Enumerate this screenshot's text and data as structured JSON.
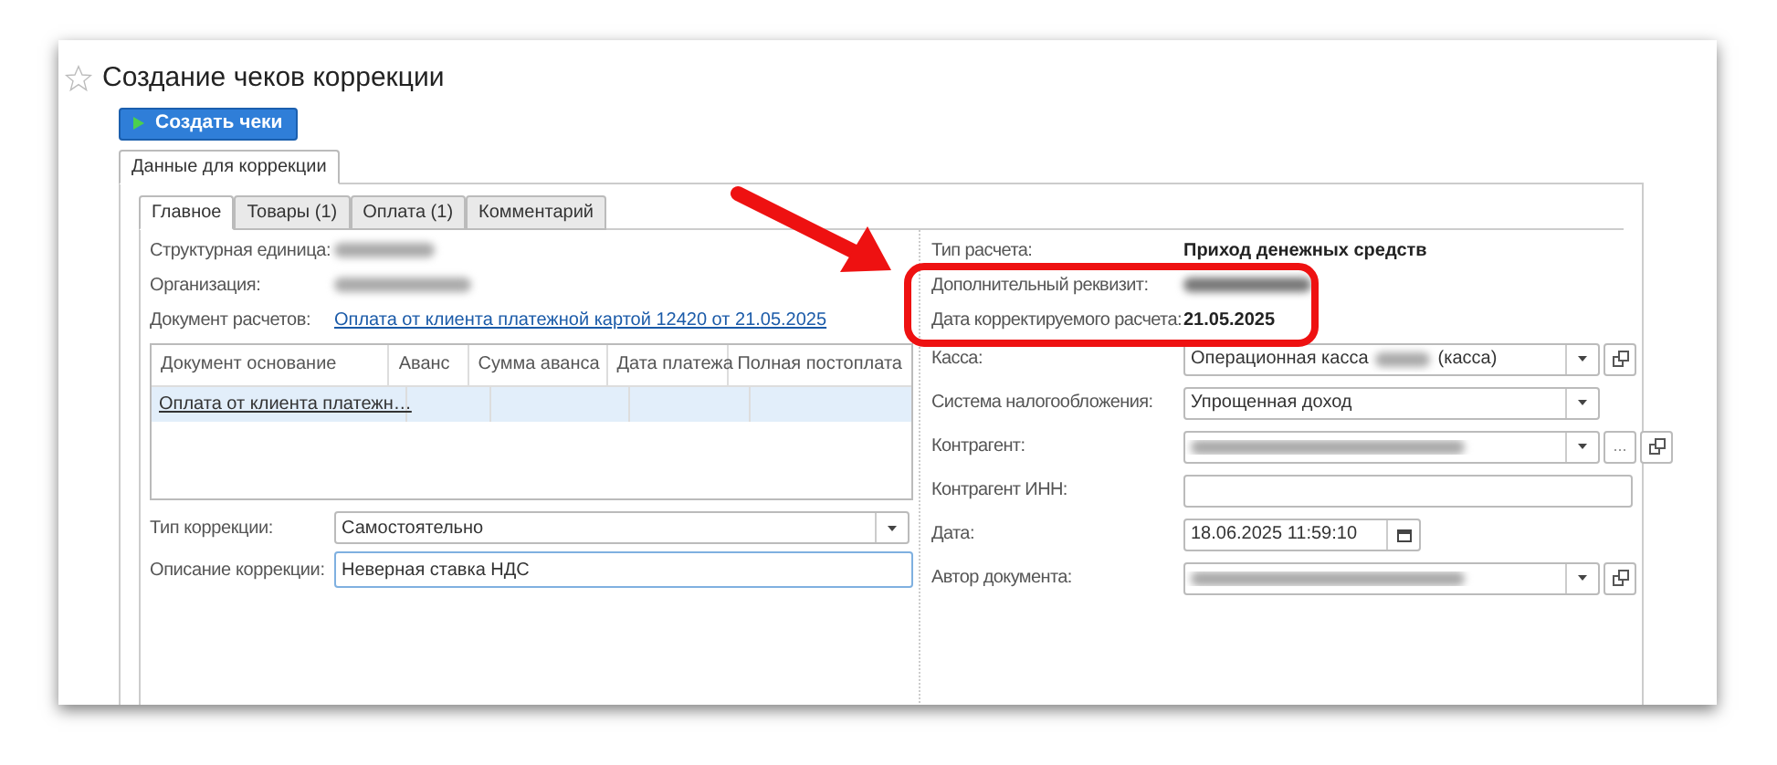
{
  "window": {
    "title": "Создание чеков коррекции",
    "favorite": false
  },
  "toolbar": {
    "button": "Создать чеки"
  },
  "outer_tabs": [
    {
      "label": "Данные для коррекции",
      "selected": true
    }
  ],
  "inner_tabs": [
    {
      "label": "Главное",
      "selected": true
    },
    {
      "label": "Товары (1)",
      "selected": false
    },
    {
      "label": "Оплата (1)",
      "selected": false
    },
    {
      "label": "Комментарий",
      "selected": false
    }
  ],
  "left_fields": [
    {
      "label": "Структурная единица:",
      "kind": "blurred"
    },
    {
      "label": "Организация:",
      "kind": "blurred"
    },
    {
      "label": "Документ расчетов:",
      "kind": "link",
      "value": "Оплата от клиента платежной картой 12420 от 21.05.2025"
    }
  ],
  "table": {
    "columns": [
      "Документ основание",
      "Аванс",
      "Сумма аванса",
      "Дата платежа",
      "Полная постоплата"
    ],
    "rows": [
      {
        "document": "Оплата от клиента платежн…",
        "selected": true
      }
    ]
  },
  "correction_type": {
    "label": "Тип коррекции:",
    "value": "Самостоятельно"
  },
  "correction_description": {
    "label": "Описание коррекции:",
    "value": "Неверная ставка НДС",
    "focused": true
  },
  "right_fields": [
    {
      "label": "Тип расчета:",
      "kind": "bold",
      "value": "Приход денежных средств"
    },
    {
      "label": "Дополнительный реквизит:",
      "kind": "blurred"
    },
    {
      "label": "Дата корректируемого расчета:",
      "kind": "bold",
      "value": "21.05.2025"
    },
    {
      "label": "Касса:",
      "kind": "select",
      "value": "Операционная касса",
      "value_end": "(касса)",
      "redacted": true,
      "open_button": true
    },
    {
      "label": "Система налогообложения:",
      "kind": "select",
      "value": "Упрощенная доход"
    },
    {
      "label": "Контрагент:",
      "kind": "select",
      "redacted": true,
      "choose_button": "...",
      "open_button": true
    },
    {
      "label": "Контрагент ИНН:",
      "kind": "input"
    },
    {
      "label": "Дата:",
      "kind": "date",
      "value": "18.06.2025 11:59:10"
    },
    {
      "label": "Автор документа:",
      "kind": "select",
      "redacted": true,
      "open_button": true
    }
  ]
}
